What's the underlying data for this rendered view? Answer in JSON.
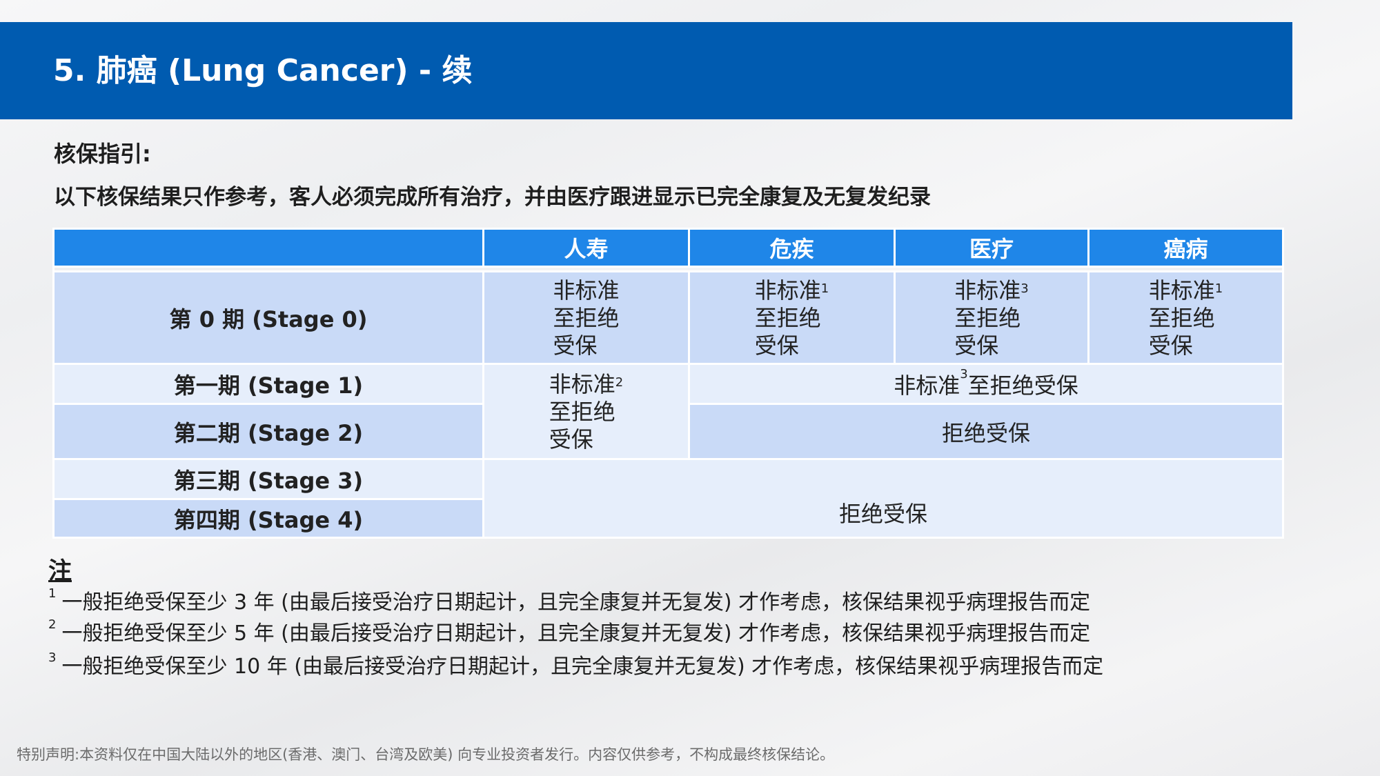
{
  "header": {
    "title": "5. 肺癌 (Lung Cancer)  - 续"
  },
  "guide": {
    "label": "核保指引:",
    "text": "以下核保结果只作参考，客人必须完成所有治疗，并由医疗跟进显示已完全康复及无复发纪录"
  },
  "table": {
    "columns": [
      "",
      "人寿",
      "危疾",
      "医疗",
      "癌病"
    ],
    "stages": [
      "第 0 期 (Stage 0)",
      "第一期 (Stage 1)",
      "第二期 (Stage 2)",
      "第三期 (Stage 3)",
      "第四期 (Stage 4)"
    ],
    "stage0": {
      "life": [
        "非标准",
        "至拒绝",
        "受保"
      ],
      "ci": {
        "word": "非标准",
        "sup": "1",
        "lines": [
          "至拒绝",
          "受保"
        ]
      },
      "medical": {
        "word": "非标准",
        "sup": "3",
        "lines": [
          "至拒绝",
          "受保"
        ]
      },
      "cancer": {
        "word": "非标准",
        "sup": "1",
        "lines": [
          "至拒绝",
          "受保"
        ]
      }
    },
    "stage12_life": {
      "word": "非标准",
      "sup": "2",
      "lines": [
        "至拒绝",
        "受保"
      ]
    },
    "stage1_others": {
      "pre": "非标准",
      "sup": "3",
      "post": "至拒绝受保"
    },
    "stage2_others": "拒绝受保",
    "stage34_all": "拒绝受保"
  },
  "notes": {
    "title": "注",
    "items": [
      {
        "mark": "1",
        "text": "一般拒绝受保至少 3 年 (由最后接受治疗日期起计，且完全康复并无复发) 才作考虑，核保结果视乎病理报告而定"
      },
      {
        "mark": "2",
        "text": "一般拒绝受保至少 5 年 (由最后接受治疗日期起计，且完全康复并无复发) 才作考虑，核保结果视乎病理报告而定"
      },
      {
        "mark": "3",
        "text": "一般拒绝受保至少 10 年 (由最后接受治疗日期起计，且完全康复并无复发) 才作考虑，核保结果视乎病理报告而定"
      }
    ]
  },
  "disclaimer": "特别声明:本资料仅在中国大陆以外的地区(香港、澳门、台湾及欧美) 向专业投资者发行。内容仅供参考，不构成最终核保结论。",
  "colors": {
    "title_bar": "#005bb0",
    "table_header": "#1f86e8",
    "row_dark": "#c9daf7",
    "row_light": "#e6eefb"
  }
}
